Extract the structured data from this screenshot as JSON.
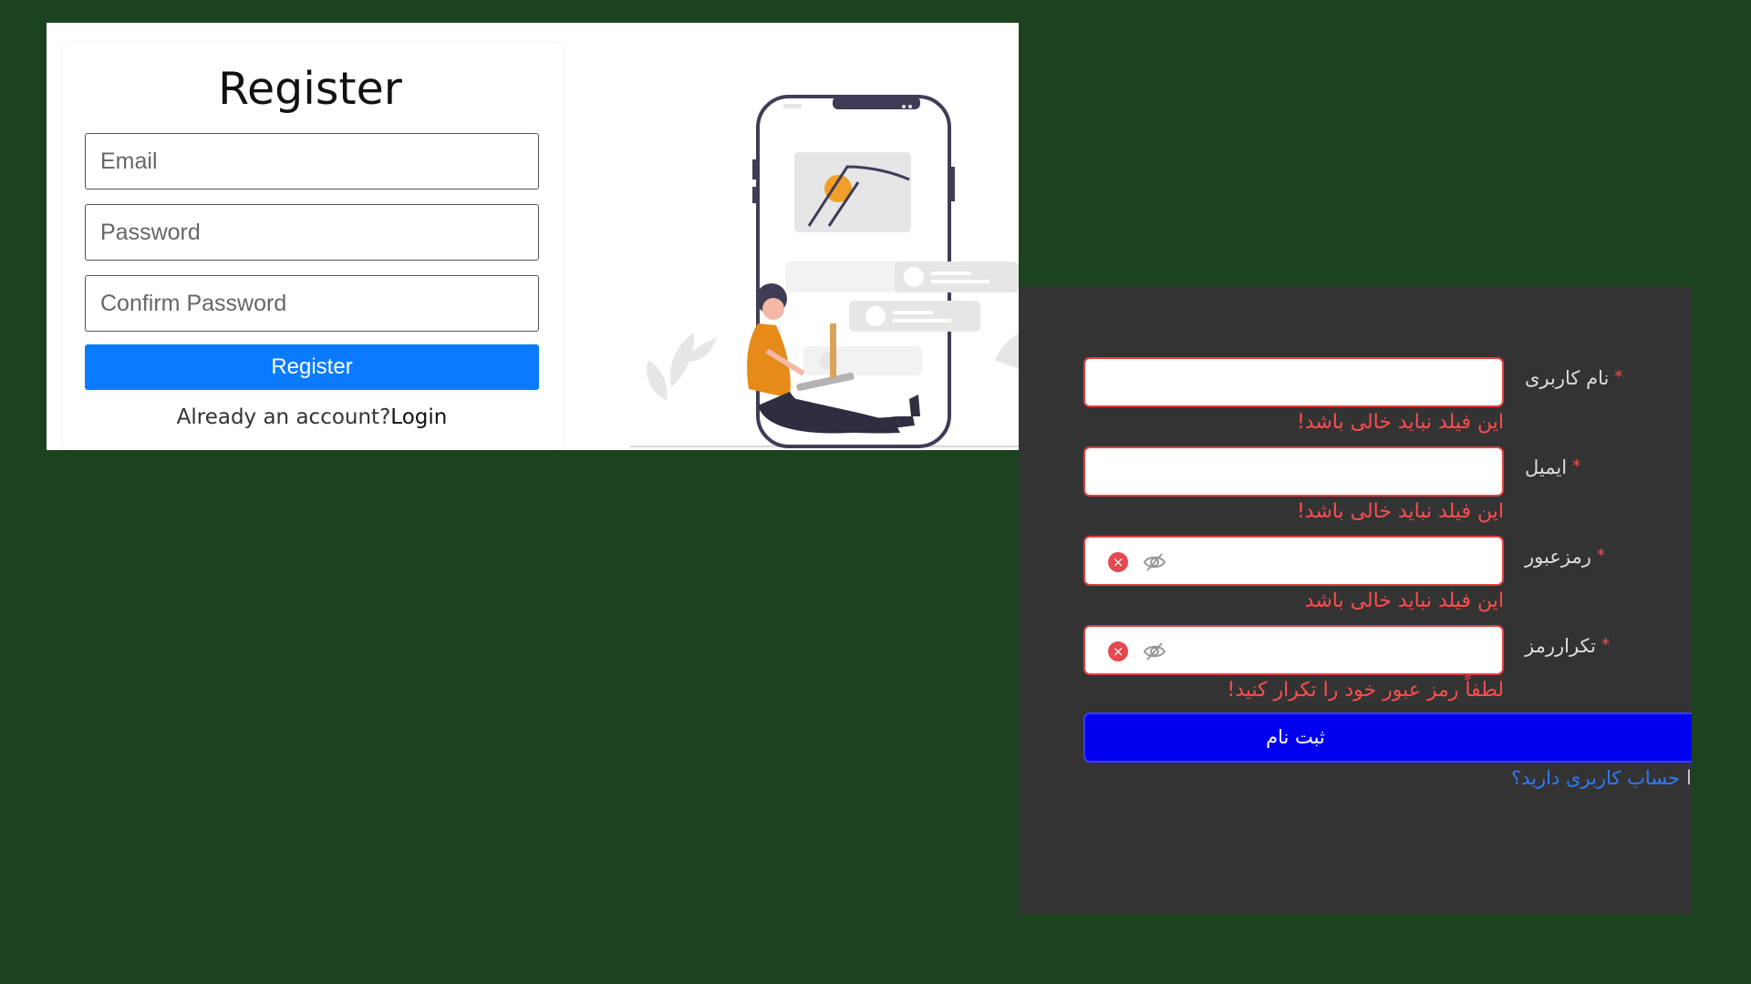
{
  "en_form": {
    "title": "Register",
    "email_placeholder": "Email",
    "password_placeholder": "Password",
    "confirm_placeholder": "Confirm Password",
    "register_button": "Register",
    "already_text": "Already an account?",
    "login_link": "Login"
  },
  "fa_form": {
    "username_label": "نام کاربری",
    "email_label": "ایمیل",
    "password_label": "رمزعبور",
    "confirm_label": "تکراررمز",
    "required_mark": "*",
    "username_error": "این فیلد نباید خالی باشد!",
    "email_error": "این فیلد نباید خالی باشد!",
    "password_error": "این فیلد نباید خالی باشد",
    "confirm_error": "لطفاً رمز عبور خود را تکرار کنید!",
    "submit_button": "ثبت نام",
    "have_account_link": "حساب کاربری دارید؟",
    "link_tail": "l"
  },
  "colors": {
    "page_bg": "#1d4220",
    "en_button": "#0a7bff",
    "fa_card_bg": "#333333",
    "fa_error": "#ff4d4f",
    "fa_button": "#0000ee",
    "fa_link": "#2f7bff"
  },
  "icons": {
    "clear": "close-circle-icon",
    "eye": "eye-invisible-icon"
  }
}
